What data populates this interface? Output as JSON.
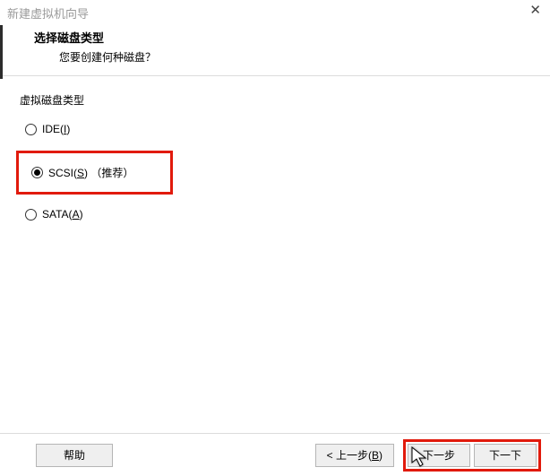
{
  "window": {
    "title": "新建虚拟机向导"
  },
  "header": {
    "title": "选择磁盘类型",
    "subtitle": "您要创建何种磁盘？"
  },
  "group": {
    "label": "虚拟磁盘类型",
    "options": {
      "ide": {
        "prefix": "IDE(",
        "accel": "I",
        "suffix": ")",
        "selected": false
      },
      "scsi": {
        "prefix": "SCSI(",
        "accel": "S",
        "suffix": ") （推荐）",
        "selected": true
      },
      "sata": {
        "prefix": "SATA(",
        "accel": "A",
        "suffix": ")",
        "selected": false
      }
    }
  },
  "footer": {
    "help": "帮助",
    "back_prefix": "< 上一步(",
    "back_accel": "B",
    "back_suffix": ")",
    "next1": "下一步",
    "next2": "下一下"
  }
}
